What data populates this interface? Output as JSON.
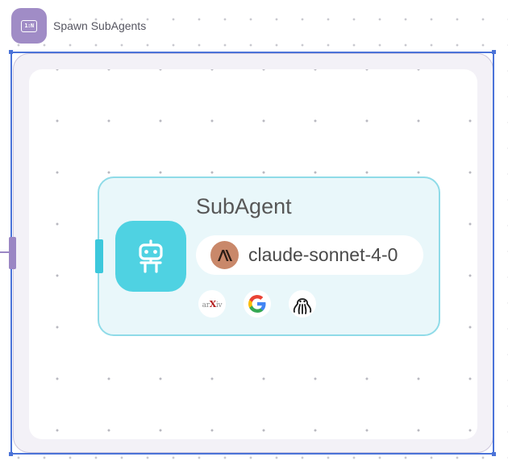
{
  "node": {
    "title": "Spawn SubAgents",
    "badge_icon": "one-to-many-icon",
    "badge_text": "1:N",
    "accent_color": "#a08cc6"
  },
  "group": {
    "selected": true,
    "selection_color": "#4b73d8"
  },
  "subagent": {
    "title": "SubAgent",
    "icon": "robot-icon",
    "accent_color": "#4fd2e2",
    "model": {
      "logo": "anthropic-icon",
      "name": "claude-sonnet-4-0"
    },
    "tools": [
      {
        "name": "arxiv-icon",
        "label": "arXiv"
      },
      {
        "name": "google-icon",
        "label": "Google"
      },
      {
        "name": "octopus-icon",
        "label": "Octopus"
      }
    ]
  }
}
